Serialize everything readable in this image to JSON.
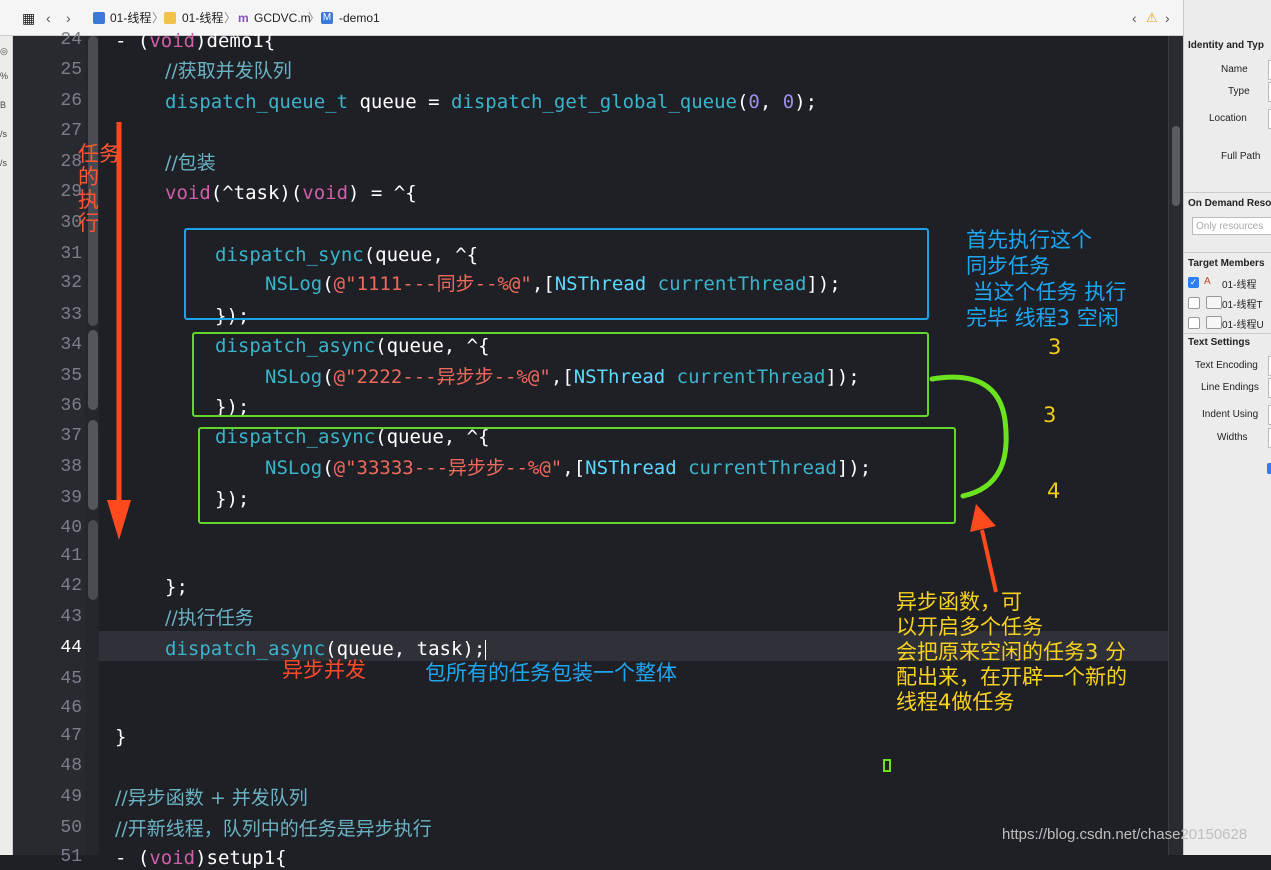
{
  "jumpbar": {
    "items": [
      "01-线程",
      "01-线程",
      "GCDVC.m",
      "-demo1"
    ]
  },
  "left_strip": [
    "%",
    "B",
    "/s",
    "/s"
  ],
  "editor": {
    "lines": [
      {
        "n": "24",
        "code": "- (void)demo1{"
      },
      {
        "n": "25",
        "code": "//获取并发队列"
      },
      {
        "n": "26",
        "code": "dispatch_queue_t queue = dispatch_get_global_queue(0, 0);"
      },
      {
        "n": "27",
        "code": ""
      },
      {
        "n": "28",
        "code": "//包装"
      },
      {
        "n": "29",
        "code": "void(^task)(void) = ^{"
      },
      {
        "n": "30",
        "code": ""
      },
      {
        "n": "31",
        "code": "dispatch_sync(queue, ^{"
      },
      {
        "n": "32",
        "code": "NSLog(@\"1111---同步--%@\",[NSThread currentThread]);"
      },
      {
        "n": "33",
        "code": "});"
      },
      {
        "n": "34",
        "code": "dispatch_async(queue, ^{"
      },
      {
        "n": "35",
        "code": "NSLog(@\"2222---异步步--%@\",[NSThread currentThread]);"
      },
      {
        "n": "36",
        "code": "});"
      },
      {
        "n": "37",
        "code": "dispatch_async(queue, ^{"
      },
      {
        "n": "38",
        "code": "NSLog(@\"33333---异步步--%@\",[NSThread currentThread]);"
      },
      {
        "n": "39",
        "code": "});"
      },
      {
        "n": "40",
        "code": ""
      },
      {
        "n": "41",
        "code": ""
      },
      {
        "n": "42",
        "code": "};"
      },
      {
        "n": "43",
        "code": "//执行任务"
      },
      {
        "n": "44",
        "code": "dispatch_async(queue, task);"
      },
      {
        "n": "45",
        "code": ""
      },
      {
        "n": "46",
        "code": ""
      },
      {
        "n": "47",
        "code": "}"
      },
      {
        "n": "48",
        "code": ""
      },
      {
        "n": "49",
        "code": "//异步函数 + 并发队列"
      },
      {
        "n": "50",
        "code": "//开新线程，队列中的任务是异步执行"
      },
      {
        "n": "51",
        "code": "- (void)setup1{"
      }
    ]
  },
  "inspector": {
    "identity_title": "Identity and Typ",
    "name_label": "Name",
    "type_label": "Type",
    "location_label": "Location",
    "full_path_label": "Full Path",
    "ondemand_title": "On Demand Reso",
    "ondemand_placeholder": "Only resources",
    "target_title": "Target Members",
    "targets": [
      "01-线程",
      "01-线程T",
      "01-线程U"
    ],
    "text_settings_title": "Text Settings",
    "text_encoding_label": "Text Encoding",
    "line_endings_label": "Line Endings",
    "indent_using_label": "Indent Using",
    "widths_label": "Widths"
  },
  "annotations": {
    "task_exec": [
      "任务",
      "的",
      "执",
      "行"
    ],
    "sync_note": [
      "首先执行这个",
      "同步任务",
      " 当这个任务 执行",
      "完毕 线程3 空闲"
    ],
    "num_a": "3",
    "num_b": "3",
    "num_c": "4",
    "async_concurrent": "异步并发",
    "wrap_note": "包所有的任务包装一个整体",
    "async_note": [
      "异步函数，可",
      "以开启多个任务",
      "会把原来空闲的任务3 分",
      "配出来，在开辟一个新的",
      "线程4做任务"
    ],
    "watermark": "https://blog.csdn.net/chase20150628"
  },
  "colors": {
    "task_exec": "#ff5533",
    "sync_box": "#1ca3e6",
    "async_box": "#62d62c",
    "sync_note": "#1ea7f0",
    "numbers": "#f0cc1a",
    "async_note": "#f6d21e",
    "async_concurrent": "#ff4a2a",
    "wrap_note": "#1ea7f0"
  }
}
